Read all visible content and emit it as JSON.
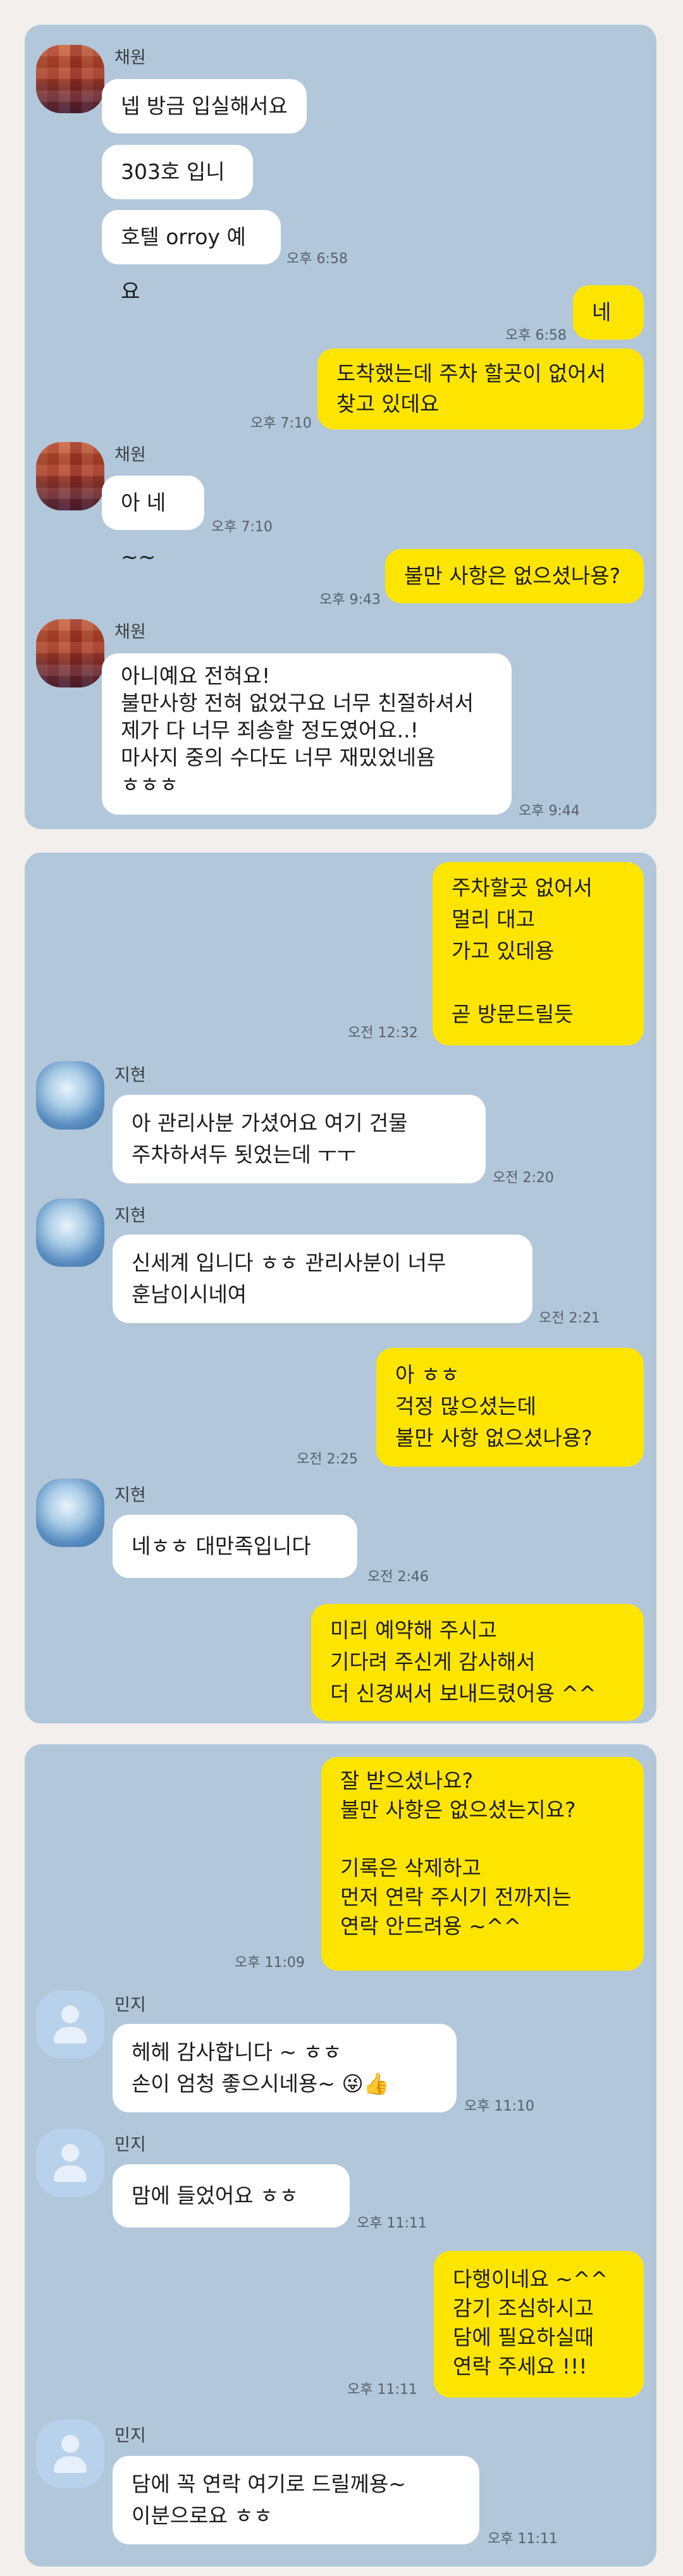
{
  "panel1": {
    "sender1": {
      "name": "채원",
      "msg1": "넵 방금 입실해서요",
      "msg2": "303호 입니다",
      "msg3": "호텔 orroy 예요",
      "time": "오후 6:58"
    },
    "me1": {
      "text": "네 ~",
      "time": "오후 6:58"
    },
    "me2": {
      "text": "도착했는데  주차 할곳이 없어서\n찾고 있데요",
      "time": "오후 7:10"
    },
    "sender2": {
      "name": "채원",
      "msg": "아 네~~",
      "time": "오후 7:10"
    },
    "me3": {
      "text": "불만 사항은 없으셨나용?",
      "time": "오후 9:43"
    },
    "sender3": {
      "name": "채원",
      "msg": "아니예요 전혀요!\n불만사항 전혀 없었구요 너무 친절하셔서\n제가 다 너무 죄송할 정도였어요..!\n마사지 중의 수다도 너무 재밌었네욤\nㅎㅎㅎ",
      "time": "오후 9:44"
    }
  },
  "panel2": {
    "me1": {
      "text": "주차할곳 없어서\n멀리 대고\n가고 있데용\n\n곧 방문드릴듯",
      "time": "오전 12:32"
    },
    "sender1": {
      "name": "지현",
      "msg": "아 관리사분 가셨어요 여기 건물\n주차하셔두 됫었는데 ㅜㅜ",
      "time": "오전 2:20"
    },
    "sender2": {
      "name": "지현",
      "msg": "신세계 입니다 ㅎㅎ 관리사분이 너무\n훈남이시네여",
      "time": "오전 2:21"
    },
    "me2": {
      "text": "아 ㅎㅎ\n걱정 많으셨는데\n불만 사항 없으셨나용?",
      "time": "오전 2:25"
    },
    "sender3": {
      "name": "지현",
      "msg": "네ㅎㅎ 대만족입니다",
      "time": "오전 2:46"
    },
    "me3": {
      "text": "미리 예약해 주시고\n기다려 주신게 감사해서\n더 신경써서 보내드렸어용 ^^"
    }
  },
  "panel3": {
    "me1": {
      "text": "잘 받으셨나요?\n불만 사항은 없으셨는지요?\n\n기록은 삭제하고\n먼저 연락 주시기 전까지는\n연락 안드려용 ~^^",
      "time": "오후 11:09"
    },
    "sender1": {
      "name": "민지",
      "msg": "헤헤 감사합니다 ~ ㅎㅎ\n손이 엄청 좋으시네용~ 😜👍",
      "time": "오후 11:10"
    },
    "sender2": {
      "name": "민지",
      "msg": "맘에 들었어요 ㅎㅎ",
      "time": "오후 11:11"
    },
    "me2": {
      "text": "다행이네요 ~^^\n감기 조심하시고\n담에 필요하실때\n연락 주세요 !!!",
      "time": "오후 11:11"
    },
    "sender3": {
      "name": "민지",
      "msg": "담에 꼭 연락 여기로 드릴께용~\n이분으로요 ㅎㅎ",
      "time": "오후 11:11"
    }
  },
  "colors": {
    "chat_bg": "#b2c7da",
    "my_bubble": "#fee500",
    "other_bubble": "#ffffff",
    "page_bg": "#f2efec"
  }
}
